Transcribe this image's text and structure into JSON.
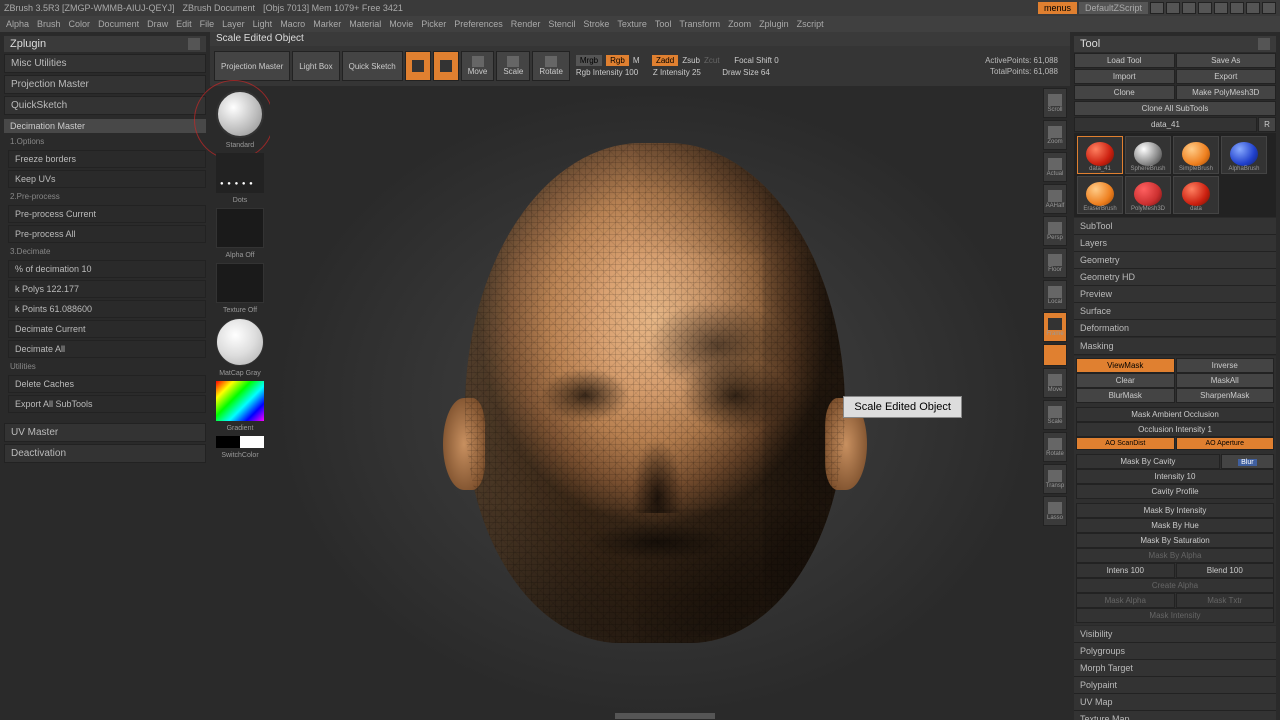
{
  "titlebar": {
    "app": "ZBrush 3.5R3  [ZMGP-WMMB-AIUJ-QEYJ]",
    "doc": "ZBrush Document",
    "stats": "[Objs 7013]  Mem 1079+  Free 3421",
    "menus": "menus",
    "zscript": "DefaultZScript"
  },
  "menubar": [
    "Alpha",
    "Brush",
    "Color",
    "Document",
    "Draw",
    "Edit",
    "File",
    "Layer",
    "Light",
    "Macro",
    "Marker",
    "Material",
    "Movie",
    "Picker",
    "Preferences",
    "Render",
    "Stencil",
    "Stroke",
    "Texture",
    "Tool",
    "Transform",
    "Zoom",
    "Zplugin",
    "Zscript"
  ],
  "left": {
    "header": "Zplugin",
    "items": [
      "Misc Utilities",
      "Projection Master",
      "QuickSketch"
    ],
    "decimation": {
      "title": "Decimation Master",
      "opt_header": "1.Options",
      "freeze": "Freeze borders",
      "keep": "Keep UVs",
      "pre_header": "2.Pre-process",
      "pre_current": "Pre-process Current",
      "pre_all": "Pre-process All",
      "dec_header": "3.Decimate",
      "pct": "% of decimation 10",
      "polys": "k Polys 122.177",
      "points": "k Points 61.088600",
      "dec_current": "Decimate Current",
      "dec_all": "Decimate All",
      "util_header": "Utilities",
      "delete": "Delete Caches",
      "export": "Export All SubTools"
    },
    "uv": "UV Master",
    "deact": "Deactivation"
  },
  "tool_header": "Scale Edited Object",
  "toolbar": {
    "projection": "Projection\nMaster",
    "lightbox": "Light Box",
    "quicksketch": "Quick\nSketch",
    "mrgb": "Mrgb",
    "rgb": "Rgb",
    "m": "M",
    "zadd": "Zadd",
    "zsub": "Zsub",
    "zcut": "Zcut",
    "rgb_int": "Rgb Intensity 100",
    "z_int": "Z Intensity 25",
    "focal": "Focal Shift 0",
    "draw": "Draw Size 64",
    "active": "ActivePoints: 61,088",
    "total": "TotalPoints: 61,088"
  },
  "brush": {
    "standard": "Standard",
    "dots": "Dots",
    "alpha": "Alpha Off",
    "texture": "Texture Off",
    "matcap": "MatCap Gray",
    "gradient": "Gradient",
    "switch": "SwitchColor"
  },
  "tooltip": "Scale Edited Object",
  "nav": [
    "Scroll",
    "Zoom",
    "Actual",
    "AAHalf",
    "Persp",
    "Floor",
    "Local",
    "Frame",
    "Move",
    "Scale",
    "Rotate",
    "Transp",
    "Lasso"
  ],
  "right": {
    "header": "Tool",
    "load": "Load Tool",
    "save": "Save As",
    "import": "Import",
    "export": "Export",
    "clone": "Clone",
    "polymesh": "Make PolyMesh3D",
    "cloneall": "Clone All SubTools",
    "data": "data_41",
    "r": "R",
    "thumbs": [
      {
        "label": "data_41",
        "cls": "thumb-red",
        "active": true
      },
      {
        "label": "SphereBrush",
        "cls": "thumb-silver"
      },
      {
        "label": "SimpleBrush",
        "cls": "thumb-orange"
      },
      {
        "label": "AlphaBrush",
        "cls": "thumb-blue"
      },
      {
        "label": "EraserBrush",
        "cls": "thumb-orange"
      },
      {
        "label": "PolyMesh3D",
        "cls": "thumb-redcap"
      },
      {
        "label": "data",
        "cls": "thumb-red"
      }
    ],
    "sections": [
      "SubTool",
      "Layers",
      "Geometry",
      "Geometry HD",
      "Preview",
      "Surface",
      "Deformation"
    ],
    "masking": {
      "title": "Masking",
      "viewmask": "ViewMask",
      "inverse": "Inverse",
      "clear": "Clear",
      "maskall": "MaskAll",
      "blurmask": "BlurMask",
      "sharpen": "SharpenMask",
      "ambient": "Mask Ambient Occlusion",
      "occ_int": "Occlusion Intensity 1",
      "scandist": "AO ScanDist",
      "aperture": "AO Aperture",
      "cavity": "Mask By Cavity",
      "blur": "Blur",
      "intensity": "Intensity 10",
      "profile": "Cavity Profile",
      "by_int": "Mask By Intensity",
      "by_hue": "Mask By Hue",
      "by_sat": "Mask By Saturation",
      "by_alpha": "Mask By Alpha",
      "intens": "Intens 100",
      "blend": "Blend 100",
      "create": "Create Alpha",
      "maskalpha": "Mask Alpha",
      "masktxtr": "Mask Txtr",
      "maskint": "Mask Intensity"
    },
    "sections2": [
      "Visibility",
      "Polygroups",
      "Morph Target",
      "Polypaint",
      "UV Map",
      "Texture Map"
    ]
  }
}
